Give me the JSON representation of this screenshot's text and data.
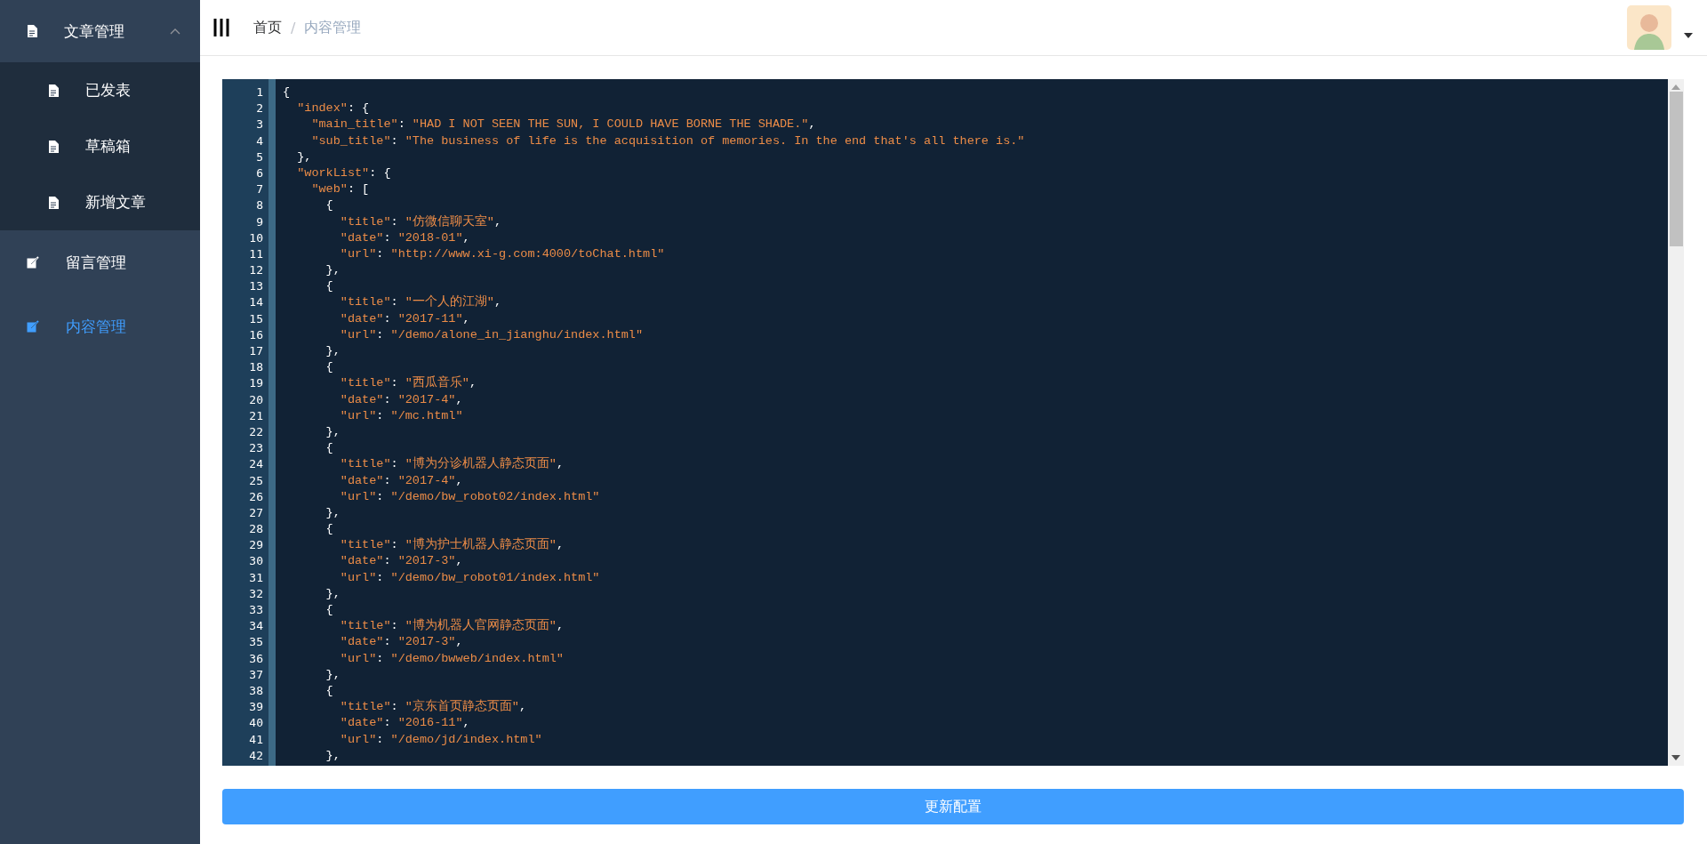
{
  "sidebar": {
    "items": [
      {
        "label": "文章管理",
        "kind": "document",
        "expanded": true,
        "selected": false,
        "children": [
          {
            "label": "已发表",
            "kind": "document",
            "selected": false
          },
          {
            "label": "草稿箱",
            "kind": "document",
            "selected": false
          },
          {
            "label": "新增文章",
            "kind": "document",
            "selected": false
          }
        ]
      },
      {
        "label": "留言管理",
        "kind": "edit",
        "selected": false
      },
      {
        "label": "内容管理",
        "kind": "edit",
        "selected": true
      }
    ]
  },
  "breadcrumb": {
    "items": [
      "首页",
      "内容管理"
    ],
    "separator": "/"
  },
  "editor": {
    "lines": [
      {
        "number": "1",
        "text": "{"
      },
      {
        "number": "2",
        "text": "  \"index\": {"
      },
      {
        "number": "3",
        "text": "    \"main_title\": \"HAD I NOT SEEN THE SUN, I COULD HAVE BORNE THE SHADE.\","
      },
      {
        "number": "4",
        "text": "    \"sub_title\": \"The business of life is the acquisition of memories. In the end that's all there is.\""
      },
      {
        "number": "5",
        "text": "  },"
      },
      {
        "number": "6",
        "text": "  \"workList\": {"
      },
      {
        "number": "7",
        "text": "    \"web\": ["
      },
      {
        "number": "8",
        "text": "      {"
      },
      {
        "number": "9",
        "text": "        \"title\": \"仿微信聊天室\","
      },
      {
        "number": "10",
        "text": "        \"date\": \"2018-01\","
      },
      {
        "number": "11",
        "text": "        \"url\": \"http://www.xi-g.com:4000/toChat.html\""
      },
      {
        "number": "12",
        "text": "      },"
      },
      {
        "number": "13",
        "text": "      {"
      },
      {
        "number": "14",
        "text": "        \"title\": \"一个人的江湖\","
      },
      {
        "number": "15",
        "text": "        \"date\": \"2017-11\","
      },
      {
        "number": "16",
        "text": "        \"url\": \"/demo/alone_in_jianghu/index.html\""
      },
      {
        "number": "17",
        "text": "      },"
      },
      {
        "number": "18",
        "text": "      {"
      },
      {
        "number": "19",
        "text": "        \"title\": \"西瓜音乐\","
      },
      {
        "number": "20",
        "text": "        \"date\": \"2017-4\","
      },
      {
        "number": "21",
        "text": "        \"url\": \"/mc.html\""
      },
      {
        "number": "22",
        "text": "      },"
      },
      {
        "number": "23",
        "text": "      {"
      },
      {
        "number": "24",
        "text": "        \"title\": \"博为分诊机器人静态页面\","
      },
      {
        "number": "25",
        "text": "        \"date\": \"2017-4\","
      },
      {
        "number": "26",
        "text": "        \"url\": \"/demo/bw_robot02/index.html\""
      },
      {
        "number": "27",
        "text": "      },"
      },
      {
        "number": "28",
        "text": "      {"
      },
      {
        "number": "29",
        "text": "        \"title\": \"博为护士机器人静态页面\","
      },
      {
        "number": "30",
        "text": "        \"date\": \"2017-3\","
      },
      {
        "number": "31",
        "text": "        \"url\": \"/demo/bw_robot01/index.html\""
      },
      {
        "number": "32",
        "text": "      },"
      },
      {
        "number": "33",
        "text": "      {"
      },
      {
        "number": "34",
        "text": "        \"title\": \"博为机器人官网静态页面\","
      },
      {
        "number": "35",
        "text": "        \"date\": \"2017-3\","
      },
      {
        "number": "36",
        "text": "        \"url\": \"/demo/bwweb/index.html\""
      },
      {
        "number": "37",
        "text": "      },"
      },
      {
        "number": "38",
        "text": "      {"
      },
      {
        "number": "39",
        "text": "        \"title\": \"京东首页静态页面\","
      },
      {
        "number": "40",
        "text": "        \"date\": \"2016-11\","
      },
      {
        "number": "41",
        "text": "        \"url\": \"/demo/jd/index.html\""
      },
      {
        "number": "42",
        "text": "      },"
      }
    ]
  },
  "submit_button": "更新配置"
}
